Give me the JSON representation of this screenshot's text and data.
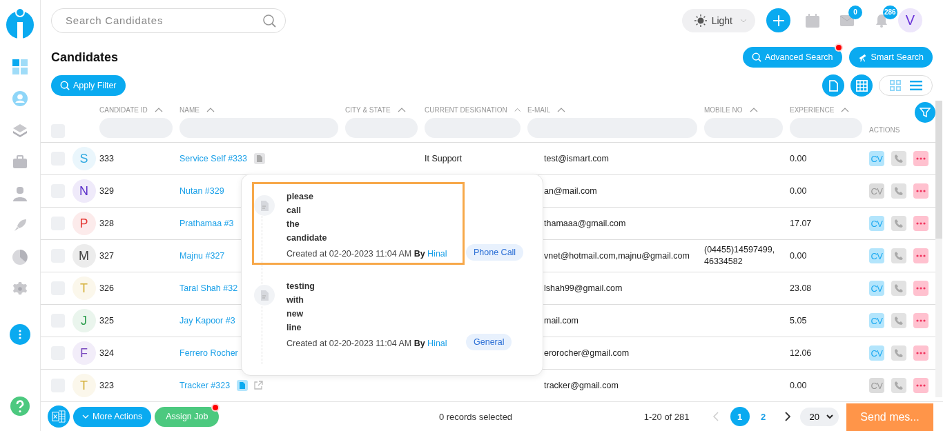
{
  "search": {
    "placeholder": "Search Candidates"
  },
  "theme": {
    "label": "Light"
  },
  "topbar": {
    "mail_badge": "0",
    "bell_badge": "286",
    "avatar": "V"
  },
  "title": "Candidates",
  "actions": {
    "advanced_search": "Advanced Search",
    "advanced_search_dot": true,
    "smart_search": "Smart Search",
    "apply_filter": "Apply Filter"
  },
  "view_toggle": [
    {
      "kind": "grid",
      "selected": false
    },
    {
      "kind": "list",
      "selected": true
    }
  ],
  "table": {
    "select_all_checked": false,
    "columns": [
      {
        "label": "CANDIDATE ID",
        "kind": "filter"
      },
      {
        "label": "NAME",
        "kind": "filter"
      },
      {
        "label": "CITY & STATE",
        "kind": "filter"
      },
      {
        "label": "CURRENT DESIGNATION",
        "kind": "filter"
      },
      {
        "label": "E-MAIL",
        "kind": "filter"
      },
      {
        "label": "MOBILE NO",
        "kind": "filter"
      },
      {
        "label": "EXPERIENCE",
        "kind": "filter"
      },
      {
        "label": "ACTIONS",
        "kind": "plain"
      }
    ],
    "rows": [
      {
        "initial": "S",
        "color": "#2ea8e0",
        "id": "333",
        "name": "Service Self #333",
        "note": {
          "active": false
        },
        "designation": "It Support",
        "email": "test@ismart.com",
        "experience": "0.00",
        "cv": true,
        "cv_label": "CV",
        "checked": false
      },
      {
        "initial": "N",
        "color": "#5b2fc9",
        "id": "329",
        "name": "Nutan #329",
        "email": "an@mail.com",
        "experience": "0.00",
        "cv": false,
        "cv_label": "CV",
        "checked": false
      },
      {
        "initial": "P",
        "color": "#e53935",
        "id": "328",
        "name": "Prathamaa #3",
        "email": "thamaaa@gmail.com",
        "experience": "17.07",
        "cv": true,
        "cv_label": "CV",
        "checked": false
      },
      {
        "initial": "M",
        "color": "#424242",
        "id": "327",
        "name": "Majnu #327",
        "email": "vnet@hotmail.com,majnu@gmail.com",
        "mobile": "(04455)14597499, 46334582",
        "experience": "0.00",
        "cv": true,
        "cv_label": "CV",
        "checked": false
      },
      {
        "initial": "T",
        "color": "#d4b03a",
        "id": "326",
        "name": "Taral Shah #32",
        "email": "lshah99@gmail.com",
        "experience": "23.08",
        "cv": true,
        "cv_label": "CV",
        "checked": false
      },
      {
        "initial": "J",
        "color": "#2e9e4f",
        "id": "325",
        "name": "Jay Kapoor #3",
        "email": "mail.com",
        "experience": "5.05",
        "cv": true,
        "cv_label": "CV",
        "checked": false
      },
      {
        "initial": "F",
        "color": "#7b4bbf",
        "id": "324",
        "name": "Ferrero Rocher",
        "email": "erorocher@gmail.com",
        "experience": "12.06",
        "cv": true,
        "cv_label": "CV",
        "checked": false
      },
      {
        "initial": "T",
        "color": "#d4b03a",
        "id": "323",
        "name": "Tracker #323",
        "note": {
          "active": true
        },
        "external_link": true,
        "email": "tracker@gmail.com",
        "experience": "0.00",
        "cv": false,
        "cv_label": "CV",
        "checked": false
      }
    ]
  },
  "notes_popup": {
    "notes": [
      {
        "text": "please\ncall\nthe\ncandidate",
        "created": "Created at 02-20-2023 11:04 AM **By**",
        "author": "Hinal",
        "tag": "Phone Call",
        "highlighted": true
      },
      {
        "text": "testing\nwith\nnew\nline",
        "created": "Created at 02-20-2023 11:04 AM **By**",
        "author": "Hinal",
        "tag": "General",
        "highlighted": false
      }
    ]
  },
  "footer": {
    "more_actions": "More Actions",
    "assign_job": "Assign Job",
    "assign_job_dot": true,
    "selection": "0 records selected",
    "range": "1-20 of 281",
    "pages": [
      {
        "label": "1",
        "selected": true
      },
      {
        "label": "2",
        "selected": false
      }
    ],
    "page_size": "20",
    "send": "Send mes..."
  }
}
